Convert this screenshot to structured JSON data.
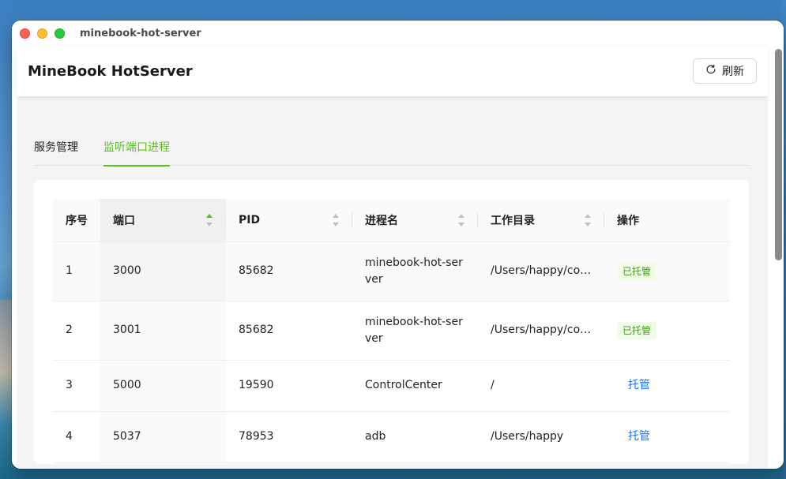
{
  "window": {
    "title": "minebook-hot-server"
  },
  "header": {
    "app_title": "MineBook HotServer",
    "refresh_label": "刷新",
    "refresh_icon": "refresh-icon"
  },
  "tabs": [
    {
      "label": "服务管理",
      "active": false
    },
    {
      "label": "监听端口进程",
      "active": true
    }
  ],
  "colors": {
    "accent": "#52c41a",
    "link": "#1677ff",
    "managed_tag_bg": "#f0fbe8",
    "managed_tag_text": "#389e0d"
  },
  "table": {
    "columns": [
      {
        "label": "序号",
        "sortable": false
      },
      {
        "label": "端口",
        "sortable": true,
        "sort": "ascending"
      },
      {
        "label": "PID",
        "sortable": true
      },
      {
        "label": "进程名",
        "sortable": true
      },
      {
        "label": "工作目录",
        "sortable": true
      },
      {
        "label": "操作",
        "sortable": false
      }
    ],
    "rows": [
      {
        "index": "1",
        "port": "3000",
        "pid": "85682",
        "process": "minebook-hot-server",
        "workdir": "/Users/happy/code/minebook-hot-server",
        "action": "已托管",
        "action_type": "tag"
      },
      {
        "index": "2",
        "port": "3001",
        "pid": "85682",
        "process": "minebook-hot-server",
        "workdir": "/Users/happy/code/minebook-hot-server",
        "action": "已托管",
        "action_type": "tag"
      },
      {
        "index": "3",
        "port": "5000",
        "pid": "19590",
        "process": "ControlCenter",
        "workdir": "/",
        "action": "托管",
        "action_type": "link"
      },
      {
        "index": "4",
        "port": "5037",
        "pid": "78953",
        "process": "adb",
        "workdir": "/Users/happy",
        "action": "托管",
        "action_type": "link"
      }
    ]
  }
}
